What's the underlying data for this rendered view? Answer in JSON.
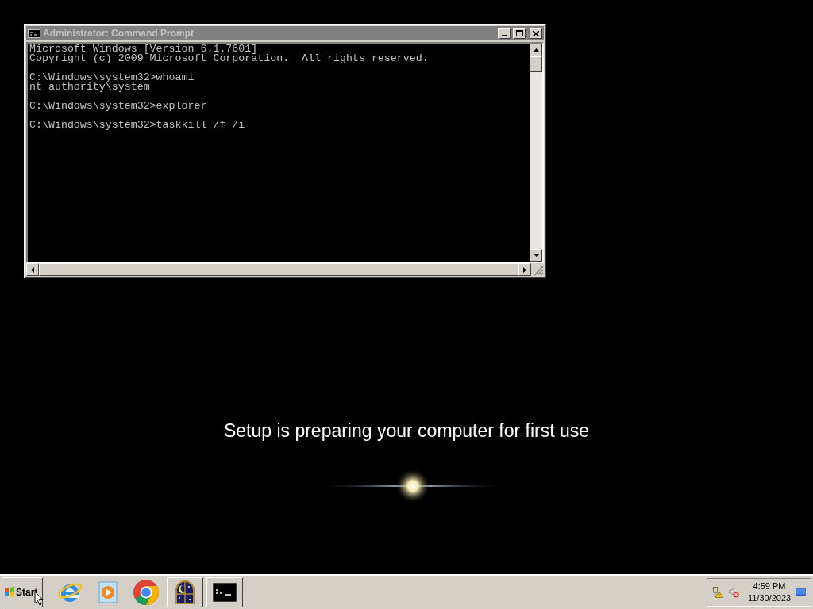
{
  "console_window": {
    "title": "Administrator: Command Prompt",
    "output_blocks": [
      [
        "Microsoft Windows [Version 6.1.7601]",
        "Copyright (c) 2009 Microsoft Corporation.  All rights reserved."
      ],
      [
        "C:\\Windows\\system32>whoami",
        "nt authority\\system"
      ],
      [
        "C:\\Windows\\system32>explorer"
      ],
      [
        "C:\\Windows\\system32>taskkill /f /i"
      ]
    ]
  },
  "setup_message": "Setup is preparing your computer for first use",
  "taskbar": {
    "start_label": "Start",
    "items": [
      {
        "kind": "browser-e"
      },
      {
        "kind": "media"
      },
      {
        "kind": "chrome"
      },
      {
        "kind": "night-window"
      },
      {
        "kind": "console"
      }
    ],
    "clock": {
      "time": "4:59 PM",
      "date": "11/30/2023"
    }
  }
}
